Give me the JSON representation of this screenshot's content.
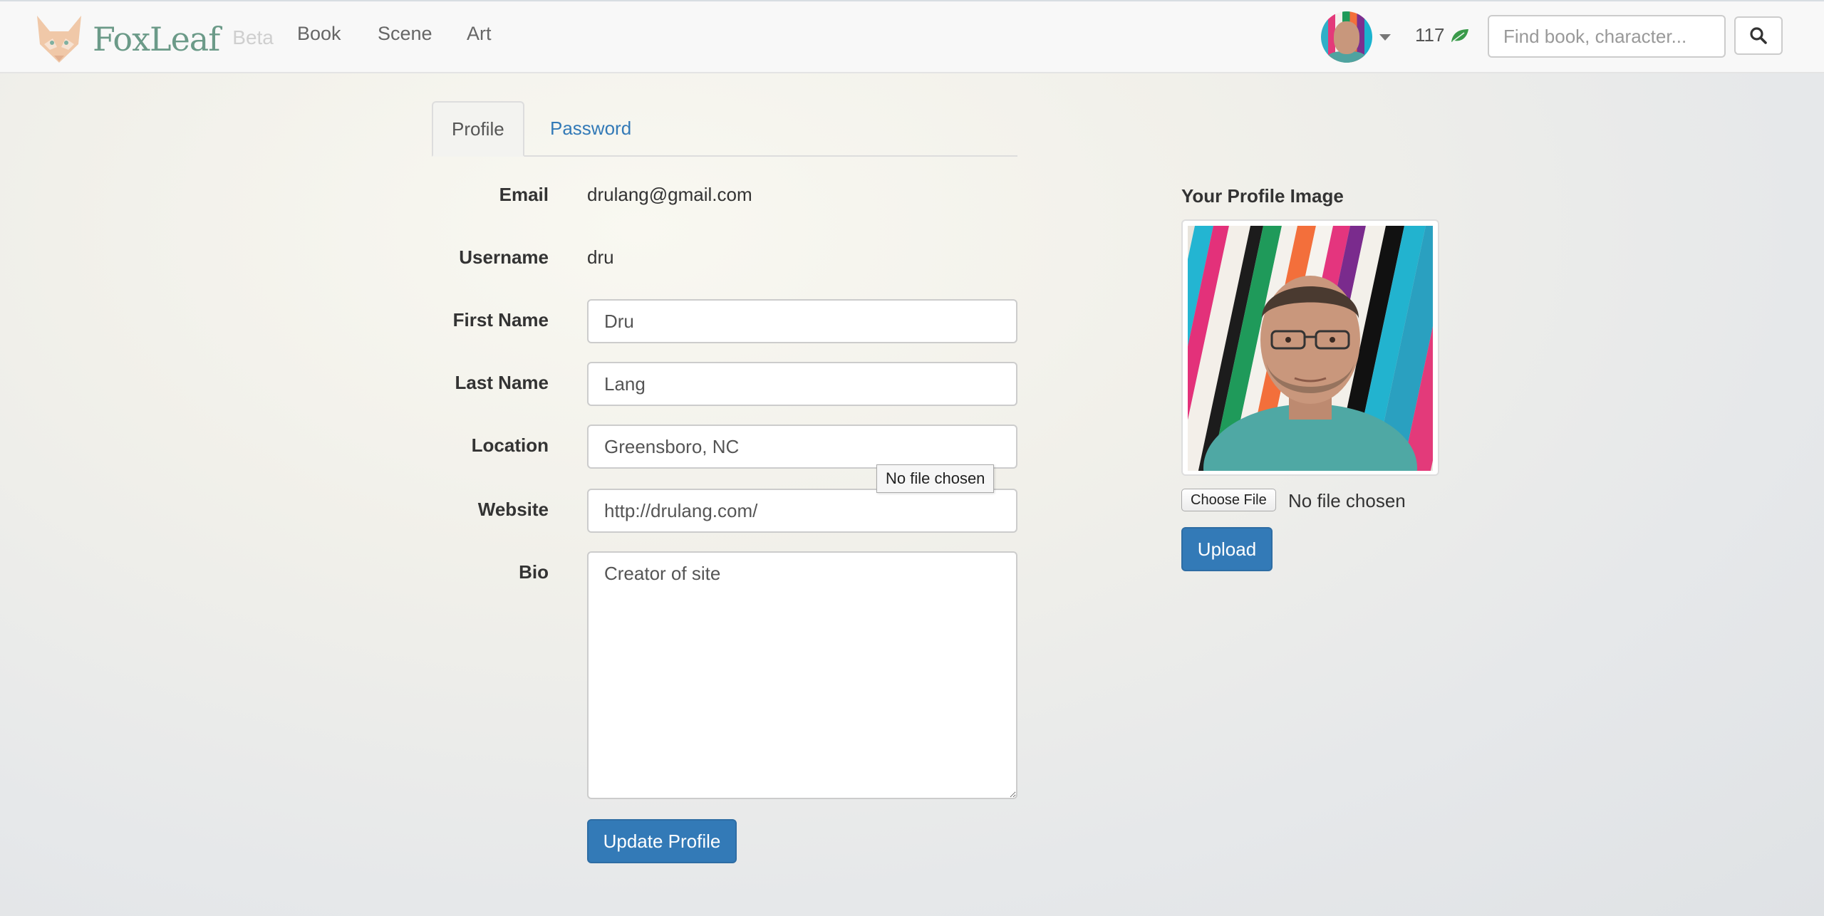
{
  "navbar": {
    "brand": "FoxLeaf",
    "beta": "Beta",
    "links": [
      "Book",
      "Scene",
      "Art"
    ],
    "points": "117",
    "search_placeholder": "Find book, character...",
    "colors": {
      "brand": "#6b9a88",
      "leaf": "#3a9a4a"
    }
  },
  "tabs": {
    "profile": "Profile",
    "password": "Password"
  },
  "form": {
    "email_label": "Email",
    "email_value": "drulang@gmail.com",
    "username_label": "Username",
    "username_value": "dru",
    "first_name_label": "First Name",
    "first_name_value": "Dru",
    "last_name_label": "Last Name",
    "last_name_value": "Lang",
    "location_label": "Location",
    "location_value": "Greensboro, NC",
    "website_label": "Website",
    "website_value": "http://drulang.com/",
    "bio_label": "Bio",
    "bio_value": "Creator of site",
    "submit_label": "Update Profile"
  },
  "tooltip": "No file chosen",
  "profile_image": {
    "title": "Your Profile Image",
    "choose_label": "Choose File",
    "file_status": "No file chosen",
    "upload_label": "Upload"
  },
  "colors": {
    "primary": "#337ab7",
    "link": "#337ab7"
  }
}
